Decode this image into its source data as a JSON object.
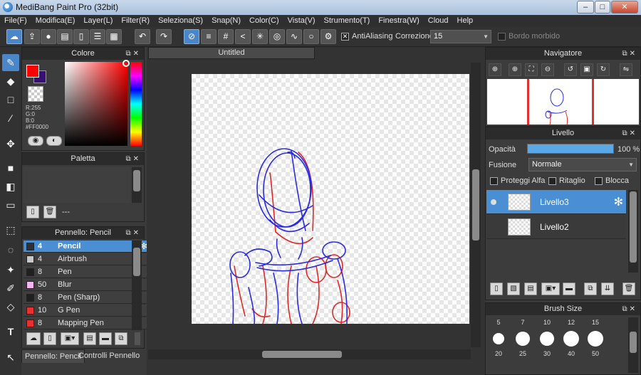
{
  "window": {
    "title": "MediBang Paint Pro (32bit)",
    "minimize": "–",
    "maximize": "□",
    "close": "✕"
  },
  "menu": [
    "File(F)",
    "Modifica(E)",
    "Layer(L)",
    "Filter(R)",
    "Seleziona(S)",
    "Snap(N)",
    "Color(C)",
    "Vista(V)",
    "Strumento(T)",
    "Finestra(W)",
    "Cloud",
    "Help"
  ],
  "toolbar": {
    "antialiasing_label": "AntiAliasing",
    "antialiasing_checked": "✕",
    "correction_label": "Correzione",
    "correction_value": "15",
    "soft_edge_label": "Bordo morbido"
  },
  "color_panel": {
    "title": "Colore",
    "foreground": "#FF0000",
    "background": "#3a0f73",
    "r": "R:255",
    "g": "G:0",
    "b": "B:0",
    "hex": "#FF0000"
  },
  "palette_panel": {
    "title": "Paletta",
    "value": "---"
  },
  "brush_panel": {
    "title": "Pennello: Pencil",
    "brushes": [
      {
        "size": "4",
        "name": "Pencil",
        "color": "#303030"
      },
      {
        "size": "4",
        "name": "Airbrush",
        "color": "#c8c8c8"
      },
      {
        "size": "8",
        "name": "Pen",
        "color": "#202020"
      },
      {
        "size": "50",
        "name": "Blur",
        "color": "#f7b6f0"
      },
      {
        "size": "8",
        "name": "Pen (Sharp)",
        "color": "#202020"
      },
      {
        "size": "10",
        "name": "G Pen",
        "color": "#e8302c"
      },
      {
        "size": "8",
        "name": "Mapping Pen",
        "color": "#e8302c"
      }
    ]
  },
  "bottom_tabs": {
    "brush_tab": "Pennello: Pencil",
    "controls_tab": "Controlli Pennello"
  },
  "document": {
    "tab": "Untitled"
  },
  "navigator": {
    "title": "Navigatore"
  },
  "layer_panel": {
    "title": "Livello",
    "opacity_label": "Opacità",
    "opacity_value": "100 %",
    "opacity_fraction": 1.0,
    "blend_label": "Fusione",
    "blend_value": "Normale",
    "protect_alpha": "Proteggi Alfa",
    "clipping": "Ritaglio",
    "lock": "Blocca",
    "layers": [
      "Livello3",
      "Livello2"
    ]
  },
  "brush_size_panel": {
    "title": "Brush Size",
    "top_sizes": [
      "5",
      "7",
      "10",
      "12",
      "15"
    ],
    "bottom_sizes": [
      "20",
      "25",
      "30",
      "40",
      "50"
    ]
  }
}
